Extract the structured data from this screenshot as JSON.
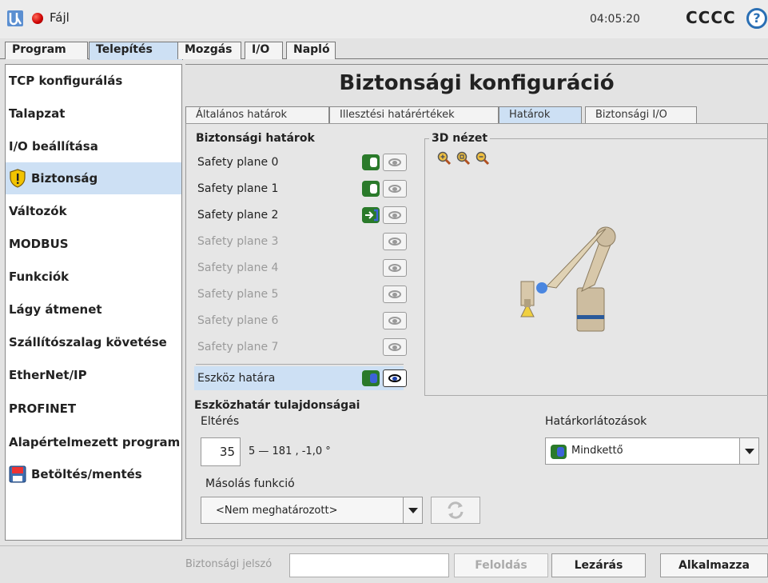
{
  "header": {
    "file_menu": "Fájl",
    "clock": "04:05:20",
    "robot_name": "CCCC",
    "help_glyph": "?"
  },
  "main_tabs": [
    "Program",
    "Telepítés",
    "Mozgás",
    "I/O",
    "Napló"
  ],
  "sidebar": {
    "items": [
      {
        "label": "TCP konfigurálás"
      },
      {
        "label": "Talapzat"
      },
      {
        "label": "I/O beállítása"
      },
      {
        "label": "Biztonság",
        "icon": "warning-shield-icon",
        "active": true
      },
      {
        "label": "Változók"
      },
      {
        "label": "MODBUS"
      },
      {
        "label": "Funkciók"
      },
      {
        "label": "Lágy átmenet"
      },
      {
        "label": "Szállítószalag követése"
      },
      {
        "label": "EtherNet/IP"
      },
      {
        "label": "PROFINET"
      },
      {
        "label": "Alapértelmezett program"
      },
      {
        "label": "Betöltés/mentés",
        "icon": "save-disk-icon"
      }
    ]
  },
  "content": {
    "title": "Biztonsági konfiguráció",
    "sub_tabs": [
      "Általános határok",
      "Illesztési határértékek",
      "Határok",
      "Biztonsági I/O"
    ],
    "limits_title": "Biztonsági határok",
    "planes": [
      {
        "label": "Safety plane 0",
        "enabled": true,
        "toggle": "normal"
      },
      {
        "label": "Safety plane 1",
        "enabled": true,
        "toggle": "normal"
      },
      {
        "label": "Safety plane 2",
        "enabled": true,
        "toggle": "switch"
      },
      {
        "label": "Safety plane 3",
        "enabled": false
      },
      {
        "label": "Safety plane 4",
        "enabled": false
      },
      {
        "label": "Safety plane 5",
        "enabled": false
      },
      {
        "label": "Safety plane 6",
        "enabled": false
      },
      {
        "label": "Safety plane 7",
        "enabled": false
      }
    ],
    "tool_limit": {
      "label": "Eszköz határa"
    },
    "view3d_label": "3D nézet",
    "props_title": "Eszközhatár tulajdonságai",
    "deviation_label": "Eltérés",
    "deviation_value": "35",
    "deviation_range": "5 — 181 , -1,0 °",
    "limit_restrictions_label": "Határkorlátozások",
    "limit_restrictions_value": "Mindkettő",
    "copy_label": "Másolás funkció",
    "copy_value": "<Nem meghatározott>"
  },
  "footer": {
    "password_label": "Biztonsági jelszó",
    "unlock": "Feloldás",
    "lock": "Lezárás",
    "apply": "Alkalmazza"
  },
  "colors": {
    "selected_blue": "#cde0f4",
    "toggle_green": "#2a7a2a",
    "accent_blue": "#2a6fb4"
  }
}
